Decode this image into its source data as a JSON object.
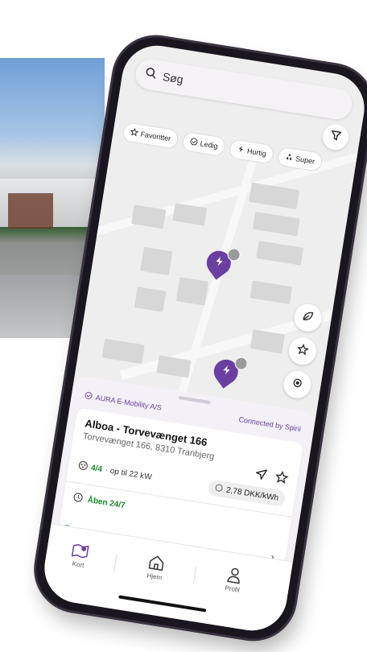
{
  "search": {
    "placeholder": "Søg"
  },
  "chips": [
    {
      "label": "Favoritter",
      "icon": "star-outline-icon"
    },
    {
      "label": "Ledig",
      "icon": "check-circle-icon"
    },
    {
      "label": "Hurtig",
      "icon": "fast-charge-icon"
    },
    {
      "label": "Super",
      "icon": "super-charge-icon"
    }
  ],
  "map": {
    "pins": [
      {
        "badge": ""
      },
      {
        "badge": ""
      }
    ]
  },
  "station": {
    "operator": "AURA E-Mobility A/S",
    "connected": "Connected by Spirii",
    "title": "Alboa - Torvevænget 166",
    "address": "Torvevænget 166, 8310 Tranbjerg",
    "available": "4/4",
    "power": "· op til 22 kW",
    "price": "2,78 DKK/kWh",
    "hours": "Åben 24/7"
  },
  "tabs": [
    {
      "label": "Kort",
      "icon": "map-pin-icon"
    },
    {
      "label": "Hjem",
      "icon": "home-icon"
    },
    {
      "label": "Profil",
      "icon": "person-icon"
    }
  ],
  "colors": {
    "accent": "#6b3fa0",
    "green": "#1a8a2e"
  }
}
